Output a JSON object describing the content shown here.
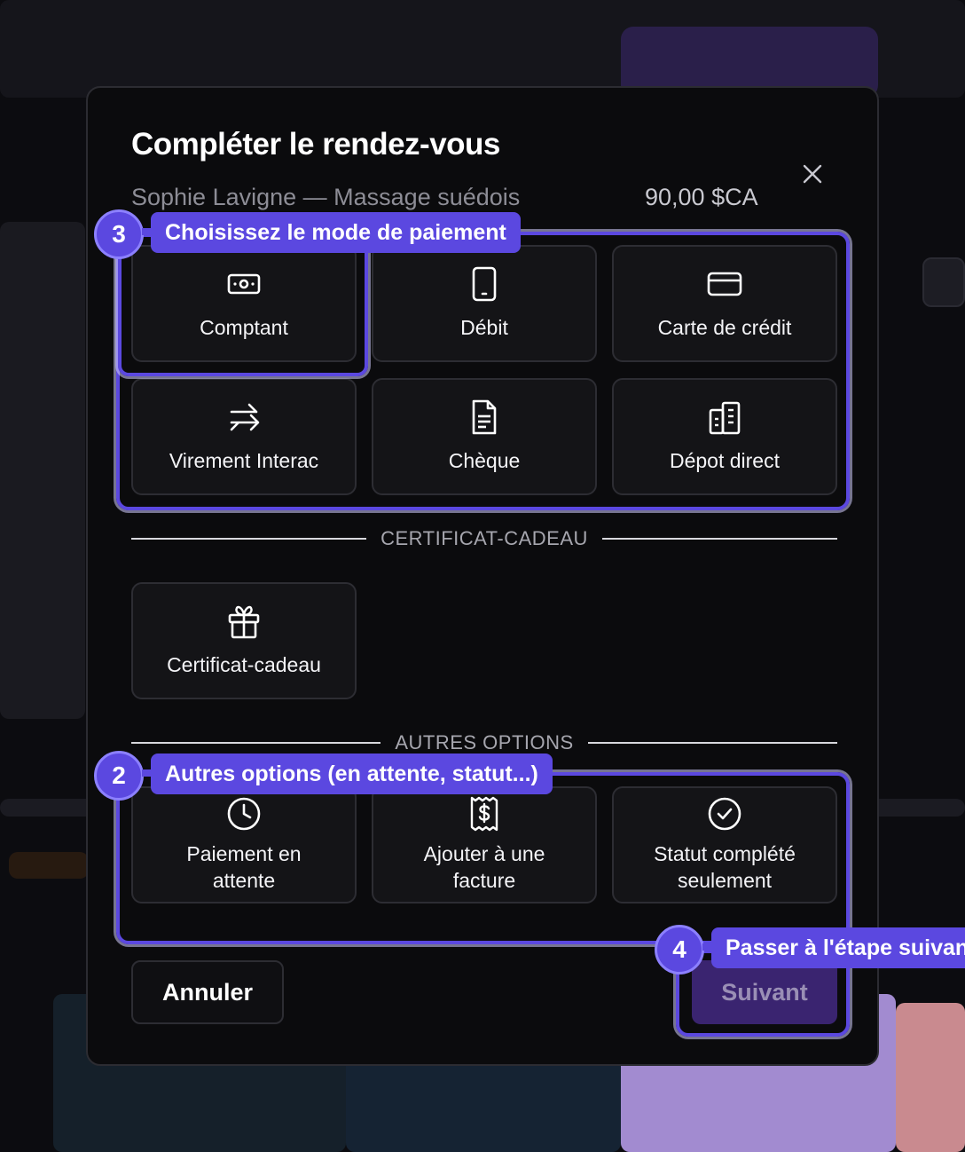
{
  "modal": {
    "title": "Compléter le rendez-vous",
    "subtitle": "Sophie Lavigne — Massage suédois",
    "price": "90,00 $CA",
    "close_icon": "close-icon"
  },
  "payment_methods": [
    {
      "label": "Comptant",
      "icon": "cash-icon"
    },
    {
      "label": "Débit",
      "icon": "tablet-icon"
    },
    {
      "label": "Carte de crédit",
      "icon": "credit-card-icon"
    },
    {
      "label": "Virement Interac",
      "icon": "transfer-arrows-icon"
    },
    {
      "label": "Chèque",
      "icon": "document-icon"
    },
    {
      "label": "Dépot direct",
      "icon": "bank-building-icon"
    }
  ],
  "gift_section": {
    "heading": "CERTIFICAT-CADEAU",
    "tile_label": "Certificat-cadeau",
    "icon": "gift-icon"
  },
  "other_section": {
    "heading": "AUTRES OPTIONS",
    "items": [
      {
        "label": "Paiement en attente",
        "icon": "clock-icon"
      },
      {
        "label": "Ajouter à une facture",
        "icon": "invoice-icon"
      },
      {
        "label": "Statut complété seulement",
        "icon": "check-circle-icon"
      }
    ]
  },
  "footer": {
    "cancel_label": "Annuler",
    "next_label": "Suivant"
  },
  "tutorial": {
    "step3": {
      "number": "3",
      "text": "Choisissez le mode de paiement"
    },
    "step2": {
      "number": "2",
      "text": "Autres options (en attente, statut...)"
    },
    "step4": {
      "number": "4",
      "text": "Passer à l'étape suivante"
    }
  },
  "colors": {
    "accent": "#5b48e0",
    "modal_bg": "#0b0b0d",
    "tile_bg": "#141417",
    "next_button": "#3a2470"
  }
}
